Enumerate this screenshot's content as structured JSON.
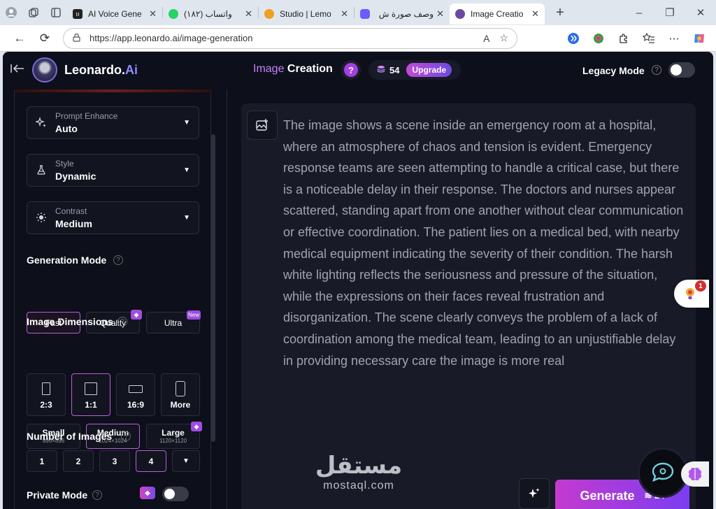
{
  "browser": {
    "tabs": [
      {
        "title": "AI Voice Gene",
        "favicon_color": "#222222",
        "active": false
      },
      {
        "title": "(١٨٢) واتساب",
        "favicon_color": "#25d366",
        "active": false
      },
      {
        "title": "Studio | Lemo",
        "favicon_color": "#f0a020",
        "active": false
      },
      {
        "title": "وصف صورة ش",
        "favicon_color": "#6a5cff",
        "active": false
      },
      {
        "title": "Image Creatio",
        "favicon_color": "#6b4aa0",
        "active": true
      }
    ],
    "url": "https://app.leonardo.ai/image-generation",
    "icons": {
      "profile": "profile-icon",
      "workspaces": "workspaces-icon",
      "tab_actions": "tab-actions-icon",
      "new_tab": "+",
      "minimize": "–",
      "restore": "❐",
      "close": "✕",
      "back": "←",
      "reload": "⟳",
      "lock": "🔒",
      "read_aloud": "A",
      "favorite": "☆",
      "more": "⋯"
    }
  },
  "header": {
    "brand_main": "Leonardo.",
    "brand_accent": "Ai",
    "mode_highlight": "Image",
    "mode_rest": " Creation",
    "help_glyph": "?",
    "tokens": "54",
    "upgrade": "Upgrade",
    "legacy_mode": "Legacy Mode"
  },
  "sidebar": {
    "prompt_enhance": {
      "label": "Prompt Enhance",
      "value": "Auto"
    },
    "style": {
      "label": "Style",
      "value": "Dynamic"
    },
    "contrast": {
      "label": "Contrast",
      "value": "Medium"
    },
    "generation_mode": {
      "title": "Generation Mode",
      "options": [
        "Fast",
        "Quality",
        "Ultra"
      ],
      "ultra_badge": "New",
      "selected": "Fast"
    },
    "image_dimensions": {
      "title": "Image Dimensions",
      "ratios": [
        "2:3",
        "1:1",
        "16:9",
        "More"
      ],
      "selected_ratio": "1:1",
      "sizes": [
        {
          "label": "Small",
          "sub": "896×896"
        },
        {
          "label": "Medium",
          "sub": "1024×1024"
        },
        {
          "label": "Large",
          "sub": "1120×1120"
        }
      ],
      "selected_size": "Medium"
    },
    "number_of_images": {
      "title": "Number of Images",
      "options": [
        "1",
        "2",
        "3",
        "4"
      ],
      "selected": "4"
    },
    "private_mode": {
      "title": "Private Mode",
      "enabled": false
    }
  },
  "main": {
    "prompt": "The image shows a scene inside an emergency room at a hospital, where an atmosphere of chaos and tension is evident. Emergency response teams are seen attempting to handle a critical case, but there is a noticeable delay in their response. The doctors and nurses appear scattered, standing apart from one another without clear communication or effective coordination. The patient lies on a medical bed, with nearby medical equipment indicating the severity of their condition. The harsh white lighting reflects the seriousness and pressure of the situation, while the expressions on their faces reveal frustration and disorganization. The scene clearly conveys the problem of a lack of coordination among the medical team, leading to an unjustifiable delay in providing necessary care the image is more real",
    "generate": "Generate",
    "generate_cost": "24"
  },
  "overlays": {
    "watermark_ar": "مستقل",
    "watermark_en": "mostaql.com",
    "extension_badge": "1"
  },
  "colors": {
    "app_bg": "#0d0f1a",
    "accent": "#b860d8",
    "generate_gradient_start": "#c43ad0",
    "generate_gradient_end": "#7b3ef0"
  }
}
